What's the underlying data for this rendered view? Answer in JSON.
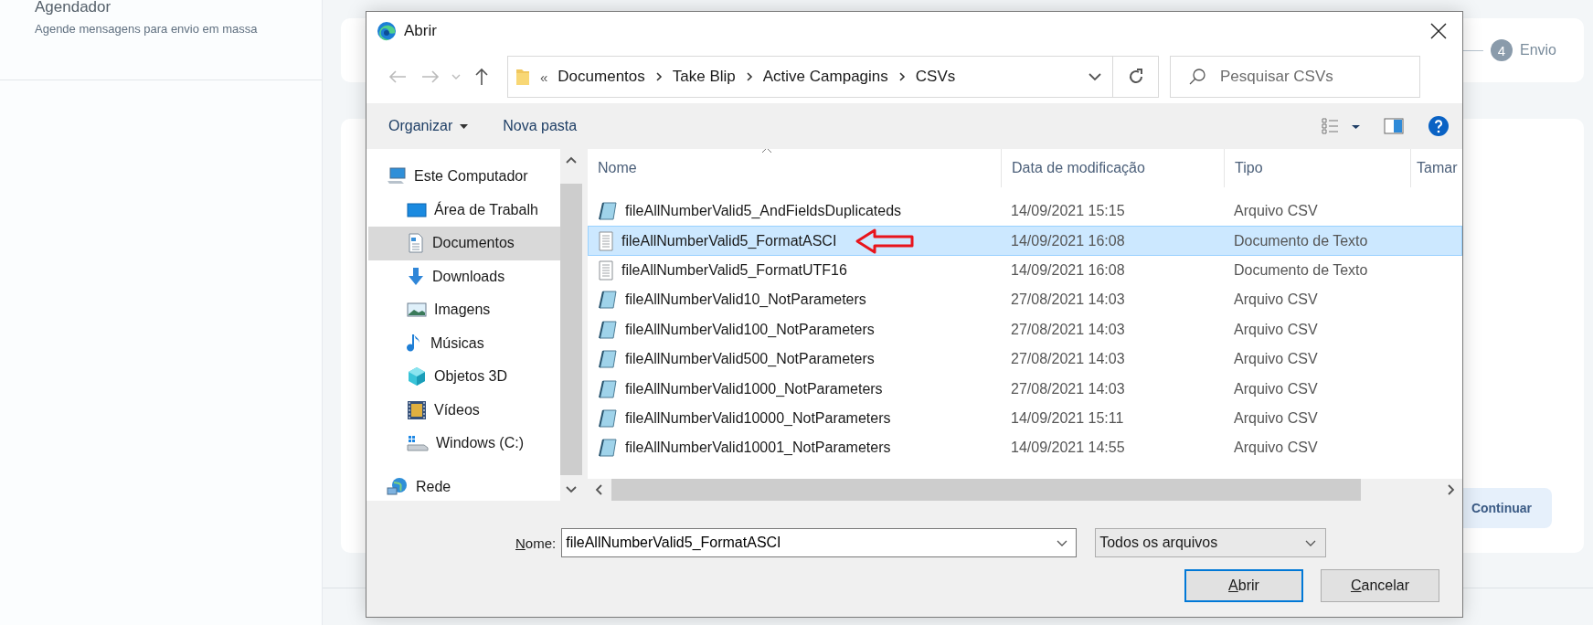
{
  "app": {
    "sidebar": {
      "title": "Agendador",
      "subtitle": "Agende mensagens para envio em massa"
    },
    "step": {
      "number": "4",
      "label": "Envio"
    },
    "continue_button": "Continuar"
  },
  "dialog": {
    "title": "Abrir",
    "breadcrumb": {
      "overflow": "«",
      "parts": [
        "Documentos",
        "Take Blip",
        "Active Campagins",
        "CSVs"
      ]
    },
    "search": {
      "placeholder": "Pesquisar CSVs"
    },
    "toolbar": {
      "organize": "Organizar",
      "new_folder": "Nova pasta"
    },
    "nav": [
      {
        "label": "Este Computador",
        "kind": "computer",
        "selected": false,
        "children": [
          {
            "label": "Área de Trabalh",
            "kind": "desktop",
            "selected": false
          },
          {
            "label": "Documentos",
            "kind": "documents",
            "selected": true
          },
          {
            "label": "Downloads",
            "kind": "downloads",
            "selected": false
          },
          {
            "label": "Imagens",
            "kind": "pictures",
            "selected": false
          },
          {
            "label": "Músicas",
            "kind": "music",
            "selected": false
          },
          {
            "label": "Objetos 3D",
            "kind": "objects",
            "selected": false
          },
          {
            "label": "Vídeos",
            "kind": "videos",
            "selected": false
          },
          {
            "label": "Windows (C:)",
            "kind": "drive",
            "selected": false
          }
        ]
      },
      {
        "label": "Rede",
        "kind": "network",
        "selected": false
      }
    ],
    "columns": [
      "Nome",
      "Data de modificação",
      "Tipo",
      "Tamar"
    ],
    "files": [
      {
        "name": "fileAllNumberValid5_AndFieldsDuplicateds",
        "date": "14/09/2021 15:15",
        "type": "Arquivo CSV",
        "kind": "csv",
        "selected": false,
        "marked": false
      },
      {
        "name": "fileAllNumberValid5_FormatASCI",
        "date": "14/09/2021 16:08",
        "type": "Documento de Texto",
        "kind": "text",
        "selected": true,
        "marked": true
      },
      {
        "name": "fileAllNumberValid5_FormatUTF16",
        "date": "14/09/2021 16:08",
        "type": "Documento de Texto",
        "kind": "text",
        "selected": false,
        "marked": false
      },
      {
        "name": "fileAllNumberValid10_NotParameters",
        "date": "27/08/2021 14:03",
        "type": "Arquivo CSV",
        "kind": "csv",
        "selected": false,
        "marked": false
      },
      {
        "name": "fileAllNumberValid100_NotParameters",
        "date": "27/08/2021 14:03",
        "type": "Arquivo CSV",
        "kind": "csv",
        "selected": false,
        "marked": false
      },
      {
        "name": "fileAllNumberValid500_NotParameters",
        "date": "27/08/2021 14:03",
        "type": "Arquivo CSV",
        "kind": "csv",
        "selected": false,
        "marked": false
      },
      {
        "name": "fileAllNumberValid1000_NotParameters",
        "date": "27/08/2021 14:03",
        "type": "Arquivo CSV",
        "kind": "csv",
        "selected": false,
        "marked": false
      },
      {
        "name": "fileAllNumberValid10000_NotParameters",
        "date": "14/09/2021 15:11",
        "type": "Arquivo CSV",
        "kind": "csv",
        "selected": false,
        "marked": false
      },
      {
        "name": "fileAllNumberValid10001_NotParameters",
        "date": "14/09/2021 14:55",
        "type": "Arquivo CSV",
        "kind": "csv",
        "selected": false,
        "marked": false
      }
    ],
    "filename_label": "Nome:",
    "filename": "fileAllNumberValid5_FormatASCI",
    "filetype": "Todos os arquivos",
    "buttons": [
      {
        "label": "Abrir",
        "kind": "primary"
      },
      {
        "label": "Cancelar",
        "kind": "secondary"
      }
    ]
  }
}
